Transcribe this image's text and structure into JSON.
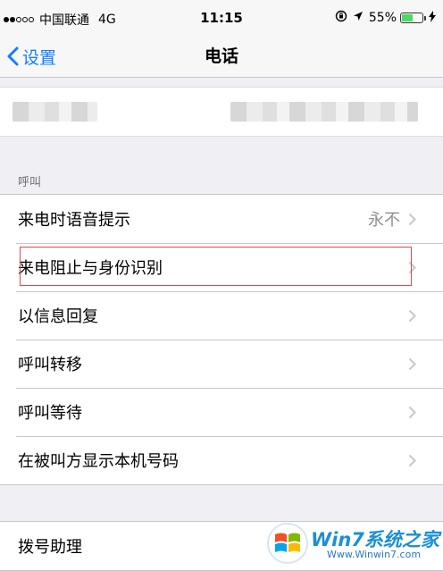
{
  "status_bar": {
    "carrier": "中国联通",
    "network": "4G",
    "time": "11:15",
    "battery": "55%",
    "battery_level": 0.55
  },
  "nav": {
    "back_label": "设置",
    "title": "电话"
  },
  "section_calls": {
    "header": "呼叫",
    "items": [
      {
        "label": "来电时语音提示",
        "value": "永不"
      },
      {
        "label": "来电阻止与身份识别",
        "value": ""
      },
      {
        "label": "以信息回复",
        "value": ""
      },
      {
        "label": "呼叫转移",
        "value": ""
      },
      {
        "label": "呼叫等待",
        "value": ""
      },
      {
        "label": "在被叫方显示本机号码",
        "value": ""
      }
    ]
  },
  "section_dial": {
    "items": [
      {
        "label": "拨号助理"
      }
    ]
  },
  "watermark": {
    "text": "Win7系统之家",
    "url": "Www.Winwin7.com"
  },
  "colors": {
    "accent": "#147efb",
    "background": "#efeff4",
    "highlight_box": "#e04a4a",
    "battery": "#4cd964"
  }
}
